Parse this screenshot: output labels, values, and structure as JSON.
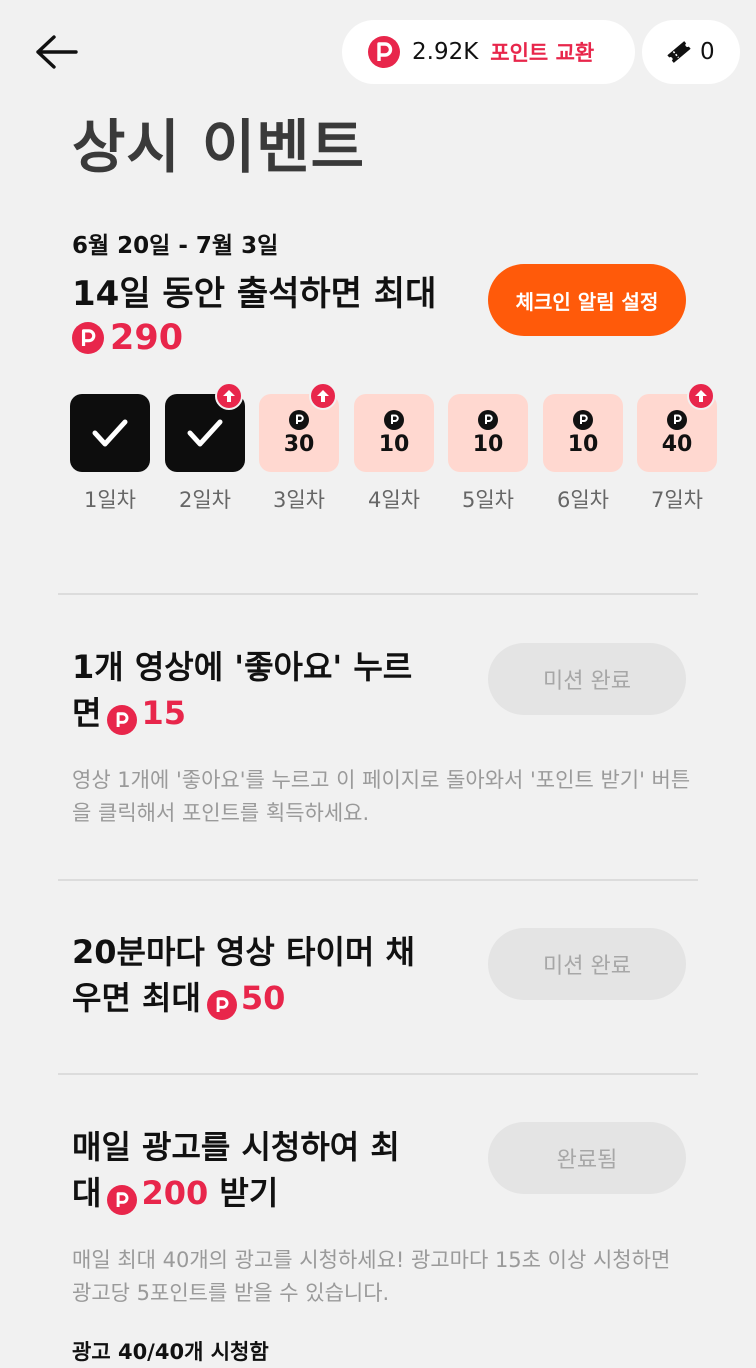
{
  "header": {
    "points_value": "2.92K",
    "points_exchange_label": "포인트 교환",
    "ticket_count": "0"
  },
  "page_title": "상시 이벤트",
  "checkin": {
    "date_range": "6월 20일 - 7월 3일",
    "title": "14일 동안 출석하면 최대",
    "max_points": "290",
    "reminder_button": "체크인 알림 설정",
    "days": [
      {
        "label": "1일차",
        "status": "done",
        "points": "",
        "boost": false
      },
      {
        "label": "2일차",
        "status": "done",
        "points": "",
        "boost": true
      },
      {
        "label": "3일차",
        "status": "todo",
        "points": "30",
        "boost": true
      },
      {
        "label": "4일차",
        "status": "todo",
        "points": "10",
        "boost": false
      },
      {
        "label": "5일차",
        "status": "todo",
        "points": "10",
        "boost": false
      },
      {
        "label": "6일차",
        "status": "todo",
        "points": "10",
        "boost": false
      },
      {
        "label": "7일차",
        "status": "todo",
        "points": "40",
        "boost": true
      }
    ]
  },
  "missions": [
    {
      "title_line1": "1개 영상에 '좋아요' 누르",
      "title_line2": "면",
      "points": "15",
      "button": "미션 완료",
      "description": "영상 1개에 '좋아요'를 누르고 이 페이지로 돌아와서 '포인트 받기' 버튼을 클릭해서 포인트를 획득하세요."
    },
    {
      "title_line1": "20분마다 영상 타이머 채",
      "title_line2": "우면 최대",
      "points": "50",
      "button": "미션 완료"
    },
    {
      "title_line1": "매일 광고를 시청하여 최",
      "title_line2": "대",
      "points": "200",
      "title_suffix": "받기",
      "button": "완료됨",
      "description": "매일 최대 40개의 광고를 시청하세요! 광고마다 15초 이상 시청하면 광고당 5포인트를 받을 수 있습니다.",
      "progress": "광고 40/40개 시청함"
    }
  ]
}
